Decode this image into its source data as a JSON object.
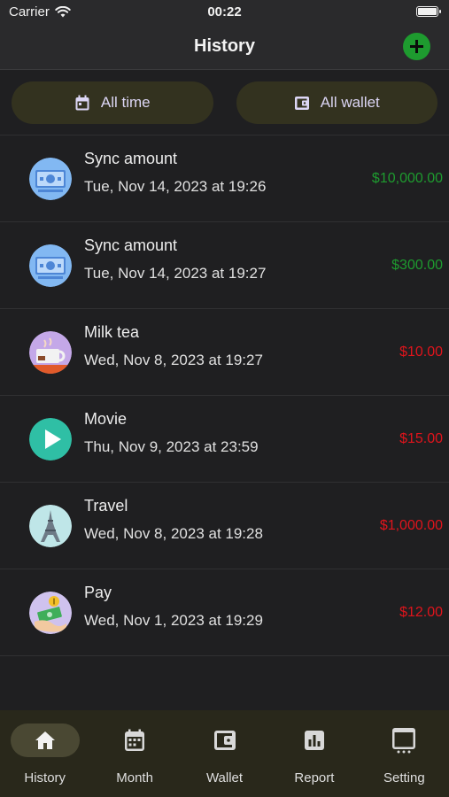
{
  "status": {
    "carrier": "Carrier",
    "time": "00:22"
  },
  "header": {
    "title": "History"
  },
  "filters": {
    "time_label": "All time",
    "wallet_label": "All wallet"
  },
  "colors": {
    "income": "#1e9b2f",
    "expense": "#e0141c",
    "accent": "#1e9b2f",
    "tabbar_bg": "#29281b"
  },
  "transactions": [
    {
      "name": "Sync amount",
      "date": "Tue, Nov 14, 2023 at 19:26",
      "amount": "$10,000.00",
      "type": "income",
      "icon": "money-icon"
    },
    {
      "name": "Sync amount",
      "date": "Tue, Nov 14, 2023 at 19:27",
      "amount": "$300.00",
      "type": "income",
      "icon": "money-icon"
    },
    {
      "name": "Milk tea",
      "date": "Wed, Nov 8, 2023 at 19:27",
      "amount": "$10.00",
      "type": "expense",
      "icon": "coffee-cup-icon"
    },
    {
      "name": "Movie",
      "date": "Thu, Nov 9, 2023 at 23:59",
      "amount": "$15.00",
      "type": "expense",
      "icon": "play-icon"
    },
    {
      "name": "Travel",
      "date": "Wed, Nov 8, 2023 at 19:28",
      "amount": "$1,000.00",
      "type": "expense",
      "icon": "eiffel-tower-icon"
    },
    {
      "name": "Pay",
      "date": "Wed, Nov 1, 2023 at 19:29",
      "amount": "$12.00",
      "type": "expense",
      "icon": "money-hand-icon"
    }
  ],
  "tabs": [
    {
      "label": "History",
      "icon": "home-icon",
      "active": true
    },
    {
      "label": "Month",
      "icon": "calendar-icon",
      "active": false
    },
    {
      "label": "Wallet",
      "icon": "wallet-icon",
      "active": false
    },
    {
      "label": "Report",
      "icon": "chart-icon",
      "active": false
    },
    {
      "label": "Setting",
      "icon": "settings-icon",
      "active": false
    }
  ]
}
